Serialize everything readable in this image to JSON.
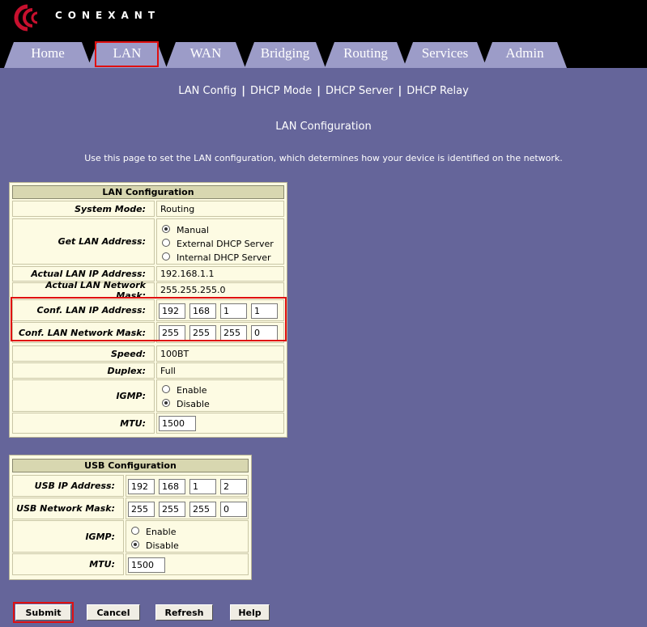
{
  "header": {
    "brand": "CONEXANT",
    "tabs": [
      {
        "label": "Home"
      },
      {
        "label": "LAN",
        "active": true
      },
      {
        "label": "WAN"
      },
      {
        "label": "Bridging"
      },
      {
        "label": "Routing"
      },
      {
        "label": "Services"
      },
      {
        "label": "Admin"
      }
    ]
  },
  "subnav": [
    "LAN Config",
    "DHCP Mode",
    "DHCP Server",
    "DHCP Relay"
  ],
  "page_title": "LAN Configuration",
  "intro": "Use this page to set the LAN configuration, which determines how your device is identified on the network.",
  "lan": {
    "title": "LAN Configuration",
    "system_mode_label": "System Mode:",
    "system_mode": "Routing",
    "get_lan_label": "Get LAN Address:",
    "get_lan_options": [
      "Manual",
      "External DHCP Server",
      "Internal DHCP Server"
    ],
    "get_lan_selected": "Manual",
    "actual_ip_label": "Actual LAN IP Address:",
    "actual_ip": "192.168.1.1",
    "actual_mask_label": "Actual LAN Network Mask:",
    "actual_mask": "255.255.255.0",
    "conf_ip_label": "Conf. LAN IP Address:",
    "conf_ip": [
      "192",
      "168",
      "1",
      "1"
    ],
    "conf_mask_label": "Conf. LAN Network Mask:",
    "conf_mask": [
      "255",
      "255",
      "255",
      "0"
    ],
    "speed_label": "Speed:",
    "speed": "100BT",
    "duplex_label": "Duplex:",
    "duplex": "Full",
    "igmp_label": "IGMP:",
    "igmp_options": [
      "Enable",
      "Disable"
    ],
    "igmp_selected": "Disable",
    "mtu_label": "MTU:",
    "mtu": "1500"
  },
  "usb": {
    "title": "USB Configuration",
    "ip_label": "USB IP Address:",
    "ip": [
      "192",
      "168",
      "1",
      "2"
    ],
    "mask_label": "USB Network Mask:",
    "mask": [
      "255",
      "255",
      "255",
      "0"
    ],
    "igmp_label": "IGMP:",
    "igmp_options": [
      "Enable",
      "Disable"
    ],
    "igmp_selected": "Disable",
    "mtu_label": "MTU:",
    "mtu": "1500"
  },
  "buttons": {
    "submit": "Submit",
    "cancel": "Cancel",
    "refresh": "Refresh",
    "help": "Help"
  },
  "colors": {
    "background": "#65659a",
    "tab": "#9c9cc8",
    "panel": "#fdfbe3",
    "highlight": "#e01010",
    "logo": "#c8102e"
  }
}
